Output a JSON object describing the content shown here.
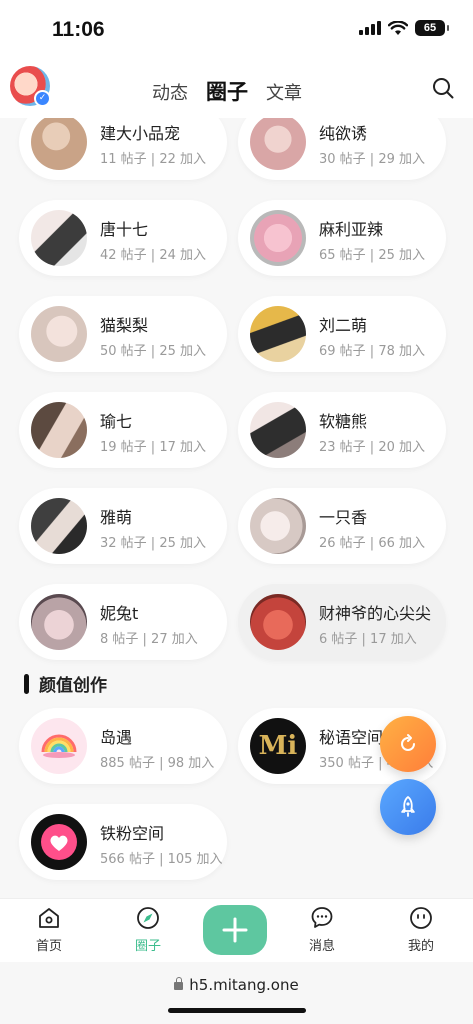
{
  "status": {
    "time": "11:06",
    "battery": "65"
  },
  "header": {
    "tabs": [
      "动态",
      "圈子",
      "文章"
    ],
    "active_tab": "圈子"
  },
  "circles": [
    {
      "name": "建大小品宠",
      "stats": "11 帖子 | 22 加入",
      "color": "#c9a387"
    },
    {
      "name": "纯欲诱",
      "stats": "30 帖子 | 29 加入",
      "color": "#d9a6a6"
    },
    {
      "name": "唐十七",
      "stats": "42 帖子 | 24 加入",
      "color": "#6b6b6b"
    },
    {
      "name": "麻利亚辣",
      "stats": "65 帖子 | 25 加入",
      "color": "#e8a3b6"
    },
    {
      "name": "猫梨梨",
      "stats": "50 帖子 | 25 加入",
      "color": "#d8c6bd"
    },
    {
      "name": "刘二萌",
      "stats": "69 帖子 | 78 加入",
      "color": "#a88b5a"
    },
    {
      "name": "瑜七",
      "stats": "19 帖子 | 17 加入",
      "color": "#8a6e5e"
    },
    {
      "name": "软糖熊",
      "stats": "23 帖子 | 20 加入",
      "color": "#8c7d7a"
    },
    {
      "name": "雅萌",
      "stats": "32 帖子 | 25 加入",
      "color": "#3f3f3f"
    },
    {
      "name": "一只香",
      "stats": "26 帖子 | 66 加入",
      "color": "#d7c9c4"
    },
    {
      "name": "妮兔t",
      "stats": "8 帖子 | 27 加入",
      "color": "#b9a3a6"
    },
    {
      "name": "财神爷的心尖尖",
      "stats": "6 帖子 | 17 加入",
      "color": "#c4443c"
    }
  ],
  "section": {
    "title": "颜值创作"
  },
  "creations": [
    {
      "name": "岛遇",
      "stats": "885 帖子 | 98 加入",
      "color": "#f5a6c0"
    },
    {
      "name": "秘语空间",
      "stats": "350 帖子 | 45 加入",
      "color": "#1a1a1a",
      "logo_text": "Mi"
    },
    {
      "name": "铁粉空间",
      "stats": "566 帖子 | 105 加入",
      "color": "#ff4f8a"
    }
  ],
  "bottom_nav": {
    "home": "首页",
    "circle": "圈子",
    "messages": "消息",
    "mine": "我的"
  },
  "url": "h5.mitang.one",
  "colors": {
    "accent": "#5ec7a0",
    "active_nav": "#3dbd8e",
    "fab_refresh": "#ff8f3d",
    "fab_rocket": "#4a90f0"
  }
}
